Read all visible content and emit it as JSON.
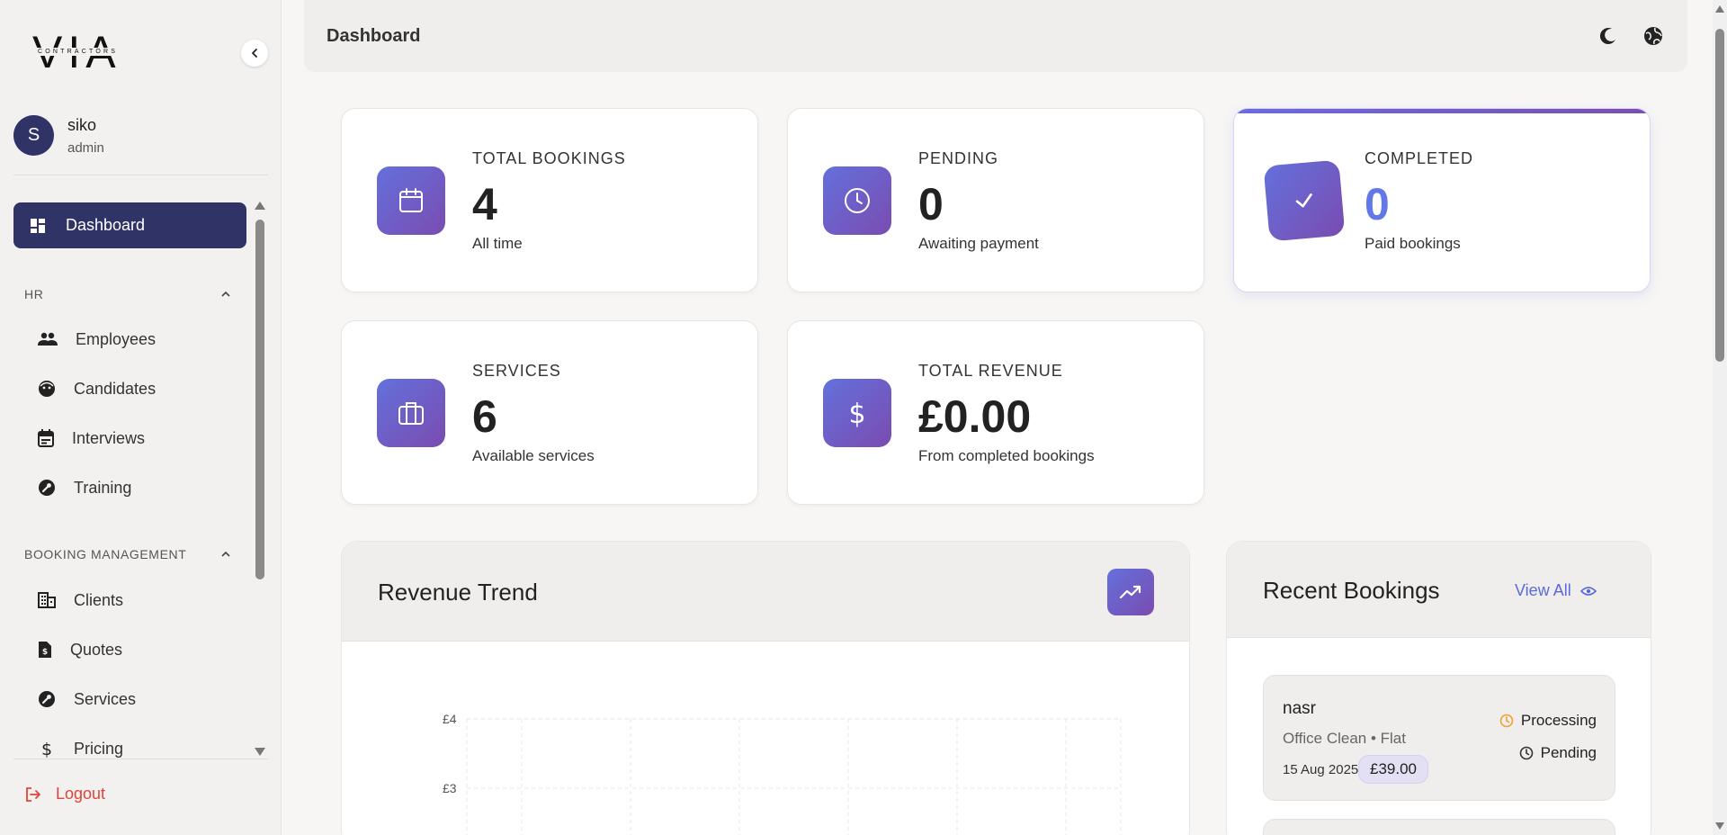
{
  "app": {
    "logo_text": "VIA",
    "logo_subtext": "CONTRACTORS"
  },
  "user": {
    "initial": "S",
    "name": "siko",
    "role": "admin"
  },
  "sidebar": {
    "active_item": {
      "label": "Dashboard",
      "icon": "dashboard-icon"
    },
    "sections": [
      {
        "title": "HR",
        "items": [
          {
            "label": "Employees",
            "icon": "people-icon"
          },
          {
            "label": "Candidates",
            "icon": "face-icon"
          },
          {
            "label": "Interviews",
            "icon": "calendar-event-icon"
          },
          {
            "label": "Training",
            "icon": "wrench-circle-icon"
          }
        ]
      },
      {
        "title": "BOOKING MANAGEMENT",
        "items": [
          {
            "label": "Clients",
            "icon": "building-icon"
          },
          {
            "label": "Quotes",
            "icon": "quote-document-icon"
          },
          {
            "label": "Services",
            "icon": "wrench-circle-icon"
          },
          {
            "label": "Pricing",
            "icon": "dollar-icon"
          }
        ]
      }
    ],
    "logout_label": "Logout"
  },
  "header": {
    "title": "Dashboard",
    "icons": [
      "moon-icon",
      "globe-icon"
    ]
  },
  "stats": [
    {
      "label": "TOTAL BOOKINGS",
      "value": "4",
      "sub": "All time",
      "icon": "calendar-icon"
    },
    {
      "label": "PENDING",
      "value": "0",
      "sub": "Awaiting payment",
      "icon": "clock-icon"
    },
    {
      "label": "COMPLETED",
      "value": "0",
      "sub": "Paid bookings",
      "icon": "check-icon"
    },
    {
      "label": "SERVICES",
      "value": "6",
      "sub": "Available services",
      "icon": "briefcase-icon"
    },
    {
      "label": "TOTAL REVENUE",
      "value": "£0.00",
      "sub": "From completed bookings",
      "icon": "dollar-icon"
    }
  ],
  "revenue_trend": {
    "title": "Revenue Trend",
    "icon": "trending-up-icon",
    "y_ticks": [
      "£4",
      "£3"
    ]
  },
  "recent_bookings": {
    "title": "Recent Bookings",
    "view_all_label": "View All",
    "items": [
      {
        "name": "nasr",
        "service": "Office Clean • Flat",
        "date": "15 Aug 2025",
        "price": "£39.00",
        "status_primary": "Processing",
        "status_secondary": "Pending"
      }
    ]
  },
  "colors": {
    "sidebar_active": "#2f3366",
    "accent_gradient_start": "#6470dc",
    "accent_gradient_end": "#7a4cb0",
    "logout": "#e0443a",
    "link": "#5b6ad6",
    "processing": "#f0a030"
  }
}
